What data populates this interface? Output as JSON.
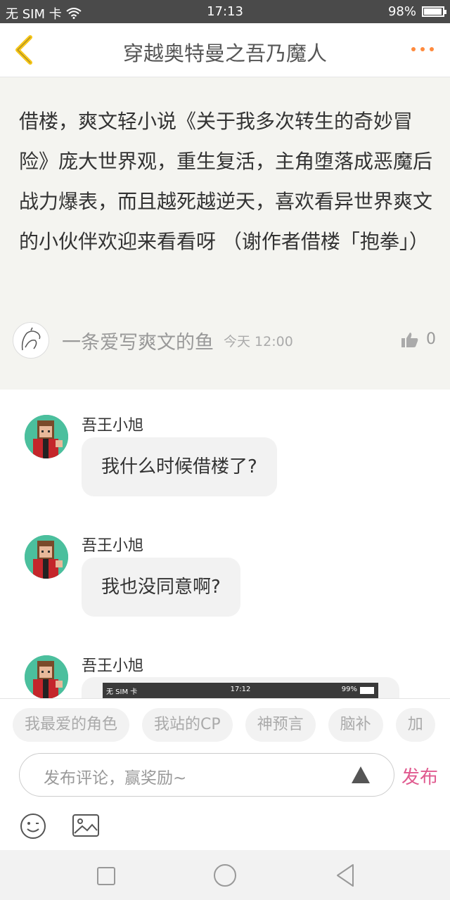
{
  "status_bar": {
    "carrier": "无 SIM 卡",
    "time": "17:13",
    "battery": "98%",
    "battery_level": 0.98
  },
  "nav": {
    "title": "穿越奥特曼之吾乃魔人"
  },
  "post": {
    "content": "借楼，爽文轻小说《关于我多次转生的奇妙冒险》庞大世界观，重生复活，主角堕落成恶魔后战力爆表，而且越死越逆天，喜欢看异世界爽文的小伙伴欢迎来看看呀 （谢作者借楼「抱拳」）",
    "author": "一条爱写爽文的鱼",
    "time": "今天 12:00",
    "likes": "0"
  },
  "comments": [
    {
      "user": "吾王小旭",
      "text": "我什么时候借楼了?"
    },
    {
      "user": "吾王小旭",
      "text": "我也没同意啊?"
    },
    {
      "user": "吾王小旭",
      "screenshot": {
        "carrier": "无 SIM 卡",
        "time": "17:12",
        "battery": "99%"
      }
    }
  ],
  "tags": [
    "我最爱的角色",
    "我站的CP",
    "神预言",
    "脑补",
    "加"
  ],
  "input": {
    "placeholder": "发布评论，赢奖励~"
  },
  "publish_label": "发布",
  "colors": {
    "status_bg": "#4a4a4a",
    "back_arrow": "#f5c518",
    "more_dots": "#ff8a3d",
    "publish": "#e05a8f",
    "post_bg": "#f4f4f0"
  }
}
